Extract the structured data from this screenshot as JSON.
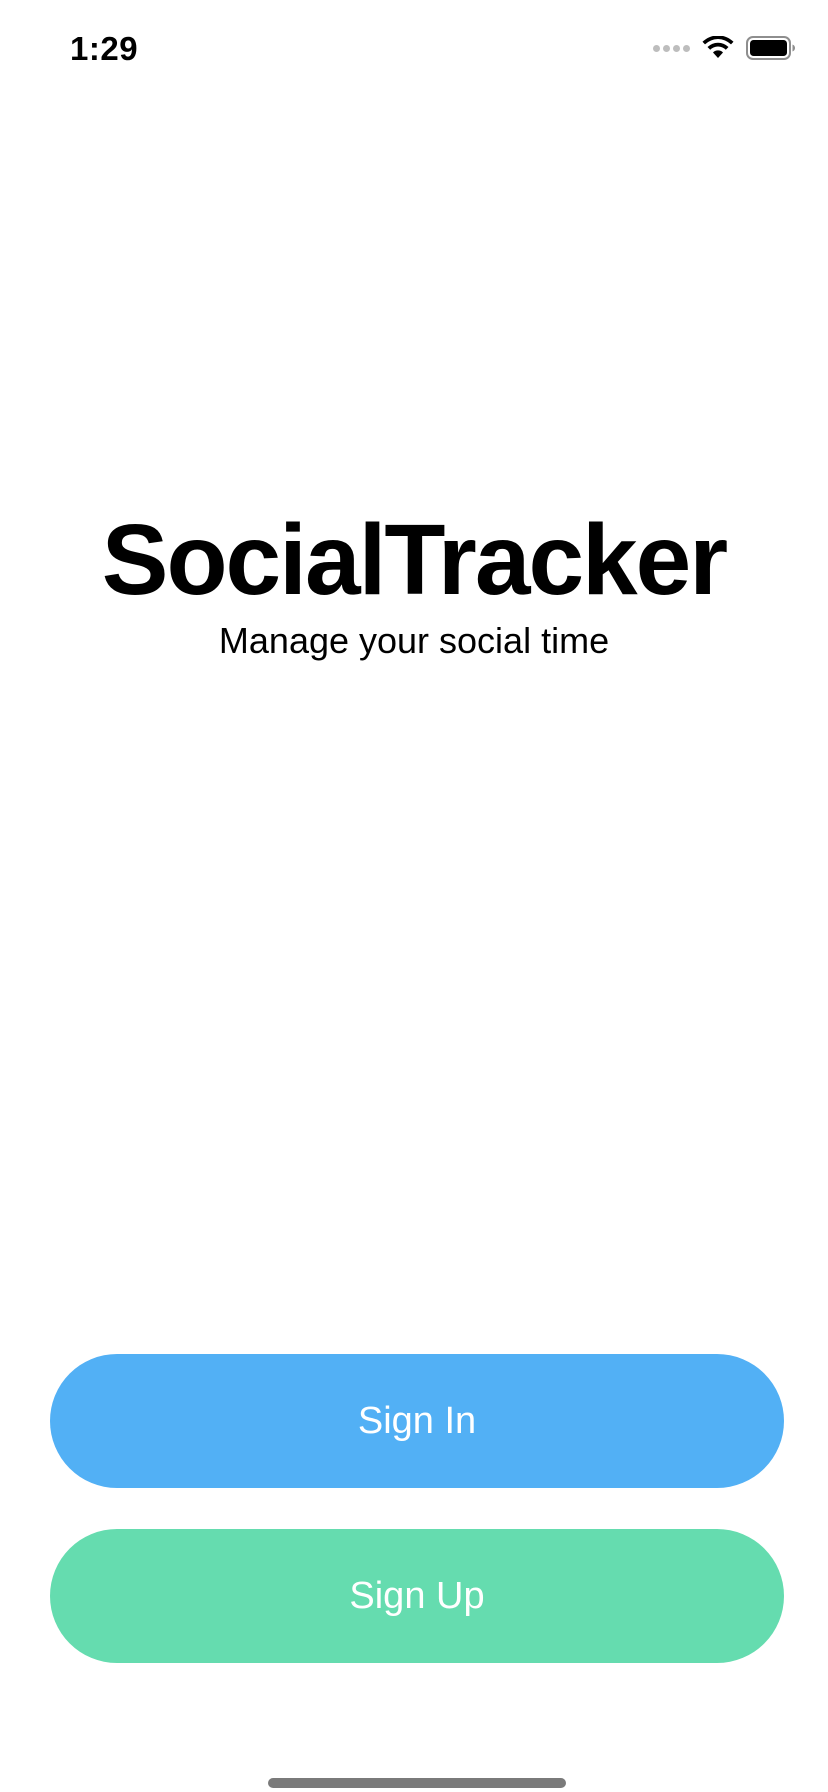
{
  "status_bar": {
    "time": "1:29",
    "icons": [
      "signal-dots-icon",
      "wifi-icon",
      "battery-icon"
    ]
  },
  "main": {
    "title": "SocialTracker",
    "subtitle": "Manage your social time"
  },
  "buttons": {
    "sign_in_label": "Sign In",
    "sign_up_label": "Sign Up"
  },
  "colors": {
    "sign_in": "#52b0f5",
    "sign_up": "#65dcaf",
    "background": "#ffffff",
    "text": "#000000"
  }
}
